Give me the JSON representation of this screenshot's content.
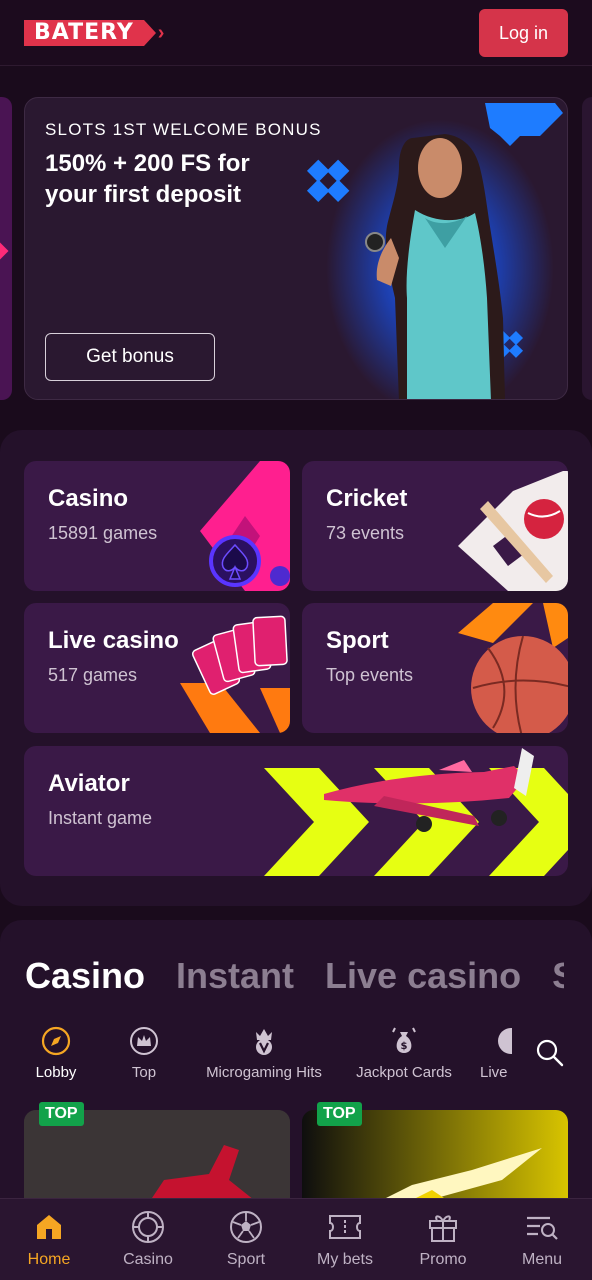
{
  "header": {
    "logo_text": "BATERY",
    "login_label": "Log in"
  },
  "banner": {
    "subtitle": "SLOTS 1ST WELCOME BONUS",
    "title": "150% + 200 FS for your first deposit",
    "cta_label": "Get bonus"
  },
  "categories": [
    {
      "title": "Casino",
      "subtitle": "15891 games"
    },
    {
      "title": "Cricket",
      "subtitle": "73 events"
    },
    {
      "title": "Live casino",
      "subtitle": "517 games"
    },
    {
      "title": "Sport",
      "subtitle": "Top events"
    },
    {
      "title": "Aviator",
      "subtitle": "Instant game"
    }
  ],
  "section_tabs": [
    {
      "label": "Casino",
      "active": true
    },
    {
      "label": "Instant",
      "active": false
    },
    {
      "label": "Live casino",
      "active": false
    }
  ],
  "sub_tabs": [
    {
      "label": "Lobby",
      "icon": "compass-icon",
      "active": true
    },
    {
      "label": "Top",
      "icon": "crown-icon",
      "active": false
    },
    {
      "label": "Microgaming Hits",
      "icon": "crown-v-icon",
      "active": false
    },
    {
      "label": "Jackpot Cards",
      "icon": "money-bag-icon",
      "active": false
    },
    {
      "label": "Live",
      "icon": "live-icon",
      "active": false
    }
  ],
  "game_cards": [
    {
      "badge": "TOP"
    },
    {
      "badge": "TOP"
    }
  ],
  "bottom_nav": [
    {
      "label": "Home",
      "icon": "home-icon",
      "active": true
    },
    {
      "label": "Casino",
      "icon": "casino-chip-icon",
      "active": false
    },
    {
      "label": "Sport",
      "icon": "soccer-ball-icon",
      "active": false
    },
    {
      "label": "My bets",
      "icon": "ticket-icon",
      "active": false
    },
    {
      "label": "Promo",
      "icon": "gift-icon",
      "active": false
    },
    {
      "label": "Menu",
      "icon": "menu-search-icon",
      "active": false
    }
  ],
  "colors": {
    "background": "#1a0b1c",
    "accent_red": "#d5344a",
    "tile_purple": "#3a1947",
    "nav_active": "#f5a623",
    "badge_green": "#12a24a"
  }
}
